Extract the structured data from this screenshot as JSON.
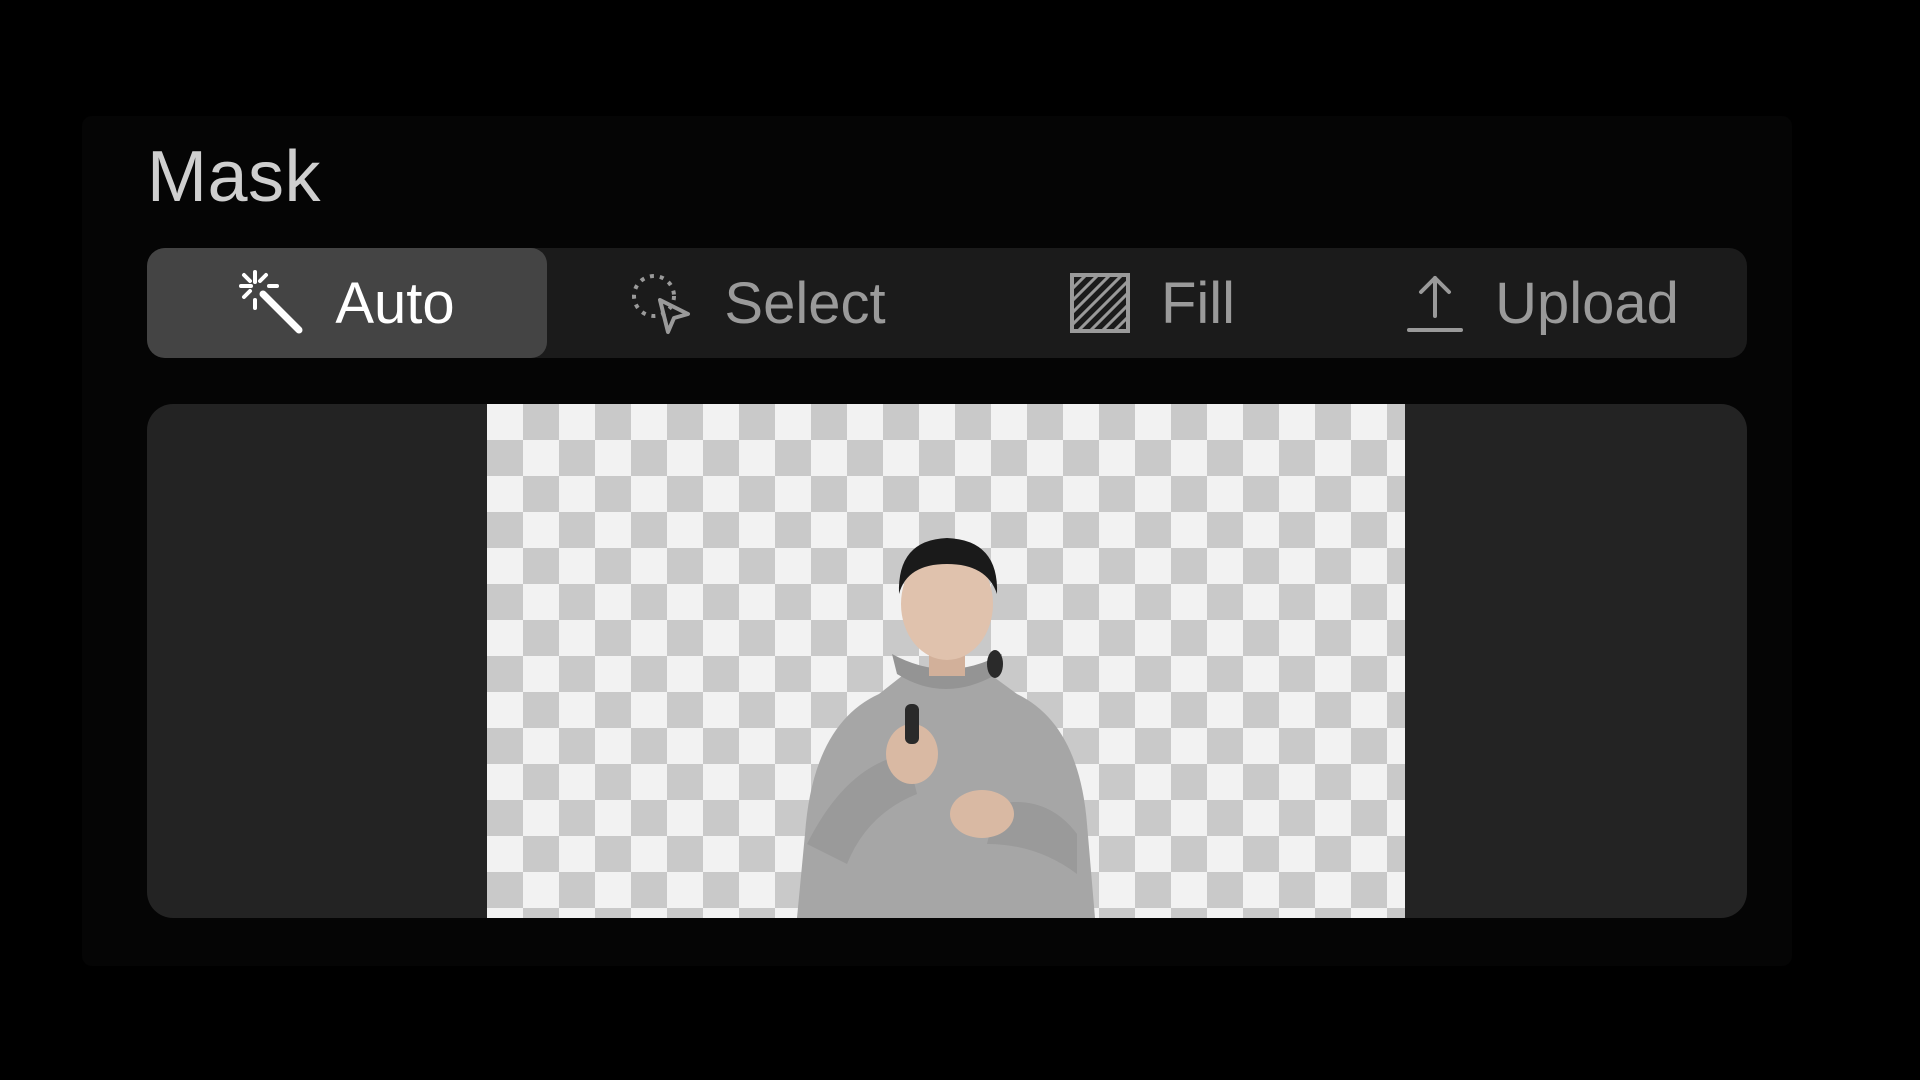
{
  "panel": {
    "title": "Mask"
  },
  "tabs": [
    {
      "label": "Auto",
      "icon": "magic-wand-icon",
      "active": true
    },
    {
      "label": "Select",
      "icon": "lasso-select-icon",
      "active": false
    },
    {
      "label": "Fill",
      "icon": "hatched-fill-icon",
      "active": false
    },
    {
      "label": "Upload",
      "icon": "upload-icon",
      "active": false
    }
  ],
  "colors": {
    "background": "#000000",
    "tabbar": "#1b1b1b",
    "active_tab": "#444444",
    "preview_bg": "#232323",
    "checker_light": "#f2f2f2",
    "checker_dark": "#c9c9c9"
  }
}
